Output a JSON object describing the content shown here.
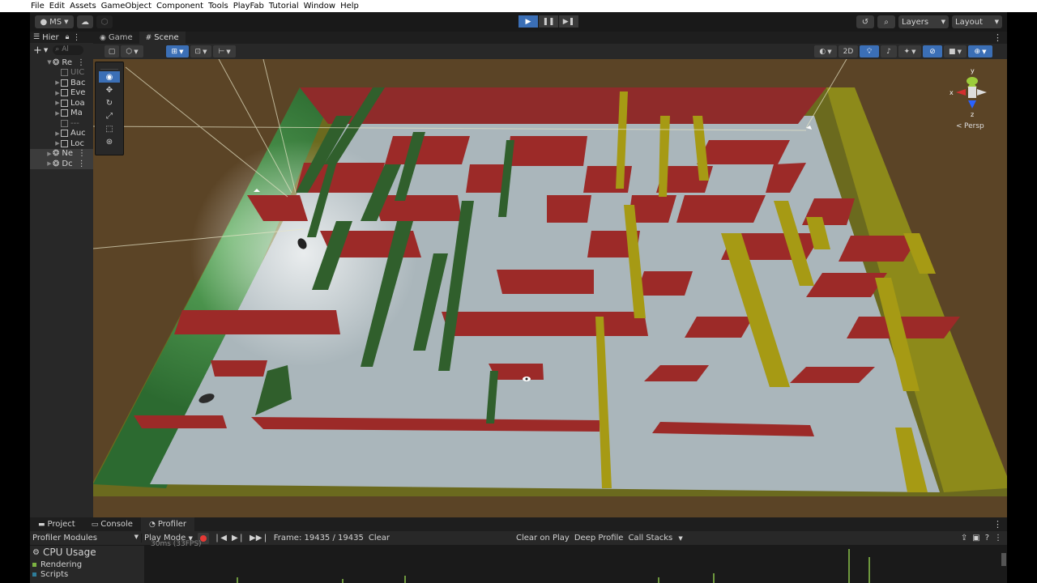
{
  "menu": [
    "File",
    "Edit",
    "Assets",
    "GameObject",
    "Component",
    "Tools",
    "PlayFab",
    "Tutorial",
    "Window",
    "Help"
  ],
  "toolbar": {
    "account_label": "MS",
    "layers_label": "Layers",
    "layout_label": "Layout"
  },
  "hierarchy": {
    "tab_label": "Hier",
    "search_placeholder": "Al",
    "items": [
      {
        "label": "Re",
        "indent": 0,
        "type": "scene"
      },
      {
        "label": "UIC",
        "indent": 1,
        "type": "cube-gray"
      },
      {
        "label": "Bac",
        "indent": 1,
        "type": "cube"
      },
      {
        "label": "Eve",
        "indent": 1,
        "type": "cube"
      },
      {
        "label": "Loa",
        "indent": 1,
        "type": "cube"
      },
      {
        "label": "Ma",
        "indent": 1,
        "type": "cube"
      },
      {
        "label": "---",
        "indent": 1,
        "type": "cube-gray"
      },
      {
        "label": "Auc",
        "indent": 1,
        "type": "cube"
      },
      {
        "label": "Loc",
        "indent": 1,
        "type": "cube"
      },
      {
        "label": "Ne",
        "indent": 0,
        "type": "scene"
      },
      {
        "label": "Dc",
        "indent": 0,
        "type": "scene"
      }
    ]
  },
  "view_tabs": [
    {
      "label": "Game",
      "icon": "gamepad-icon",
      "active": false
    },
    {
      "label": "Scene",
      "icon": "grid-icon",
      "active": true
    }
  ],
  "scene_toolbar": {
    "mode_2d_label": "2D"
  },
  "gizmo": {
    "y_label": "y",
    "x_label": "x",
    "z_label": "z",
    "projection_label": "Persp"
  },
  "bottom_tabs": [
    {
      "label": "Project",
      "icon": "folder-icon"
    },
    {
      "label": "Console",
      "icon": "console-icon"
    },
    {
      "label": "Profiler",
      "icon": "profiler-icon"
    }
  ],
  "profiler": {
    "modules_label": "Profiler Modules",
    "play_mode_label": "Play Mode",
    "frame_label": "Frame: 19435 / 19435",
    "clear_label": "Clear",
    "clear_on_play_label": "Clear on Play",
    "deep_profile_label": "Deep Profile",
    "call_stacks_label": "Call Stacks",
    "cpu_usage_label": "CPU Usage",
    "modules": [
      {
        "label": "Rendering",
        "color": "#7cb342"
      },
      {
        "label": "Scripts",
        "color": "#2e7d9a"
      }
    ],
    "graph_header": "30ms (33FPS)"
  }
}
